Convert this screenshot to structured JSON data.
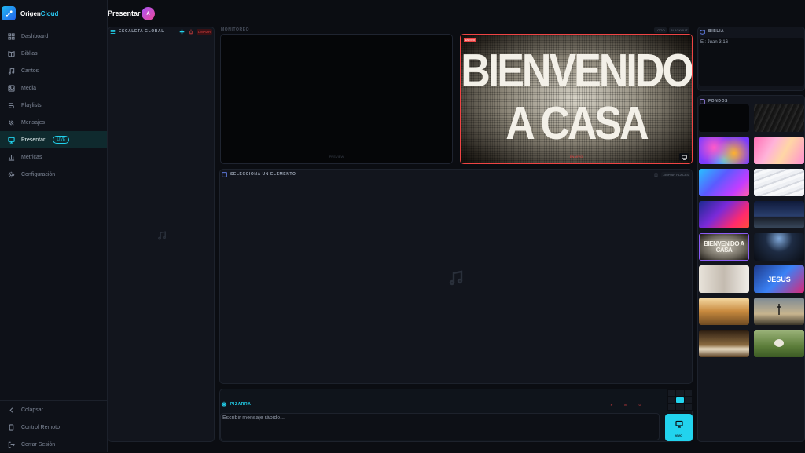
{
  "app": {
    "name_part1": "Origen",
    "name_part2": "Cloud"
  },
  "sidebar": {
    "items": [
      {
        "label": "Dashboard",
        "icon": "grid-icon"
      },
      {
        "label": "Biblias",
        "icon": "book-icon"
      },
      {
        "label": "Cantos",
        "icon": "music-note-icon"
      },
      {
        "label": "Media",
        "icon": "image-icon"
      },
      {
        "label": "Playlists",
        "icon": "playlist-icon"
      },
      {
        "label": "Mensajes",
        "icon": "message-icon"
      },
      {
        "label": "Presentar",
        "icon": "monitor-icon",
        "badge": "LIVE",
        "active": true
      },
      {
        "label": "Métricas",
        "icon": "bar-chart-icon"
      },
      {
        "label": "Configuración",
        "icon": "gear-icon"
      }
    ],
    "bottom": [
      {
        "label": "Colapsar",
        "icon": "chevron-left-icon"
      },
      {
        "label": "Control Remoto",
        "icon": "phone-icon"
      },
      {
        "label": "Cerrar Sesión",
        "icon": "logout-icon"
      }
    ]
  },
  "header": {
    "title": "Presentar",
    "avatar_initial": "A"
  },
  "escaleta": {
    "title": "ESCALETA GLOBAL",
    "clear_label": "LIMPIAR"
  },
  "monitoreo": {
    "title": "MONITOREO",
    "preview_label": "PREVIEW",
    "live_tag": "EN VIVO",
    "live_caption": "EN VIVO",
    "live_text_line1": "BIENVENIDO",
    "live_text_line2": "A CASA",
    "logo_label": "LOGO",
    "blackout_label": "BLACKOUT"
  },
  "select_element": {
    "title": "SELECCIONA UN ELEMENTO",
    "clear_label": "LIMPIAR PLACAS"
  },
  "pizarra": {
    "title": "PIZARRA",
    "placeholder": "Escribir mensaje rápido...",
    "format_buttons": [
      "P",
      "M",
      "G"
    ],
    "send_label": "VIVO"
  },
  "biblia": {
    "title": "BIBLIA",
    "reference": "Ej: Juan 3:16"
  },
  "fondos": {
    "title": "FONDOS",
    "thumb_text": "BIENVENIDO A CASA",
    "thumb_jesus": "JESUS"
  },
  "colors": {
    "accent": "#22d3ee",
    "live": "#ef4444",
    "brand": "#1fb8f2"
  }
}
